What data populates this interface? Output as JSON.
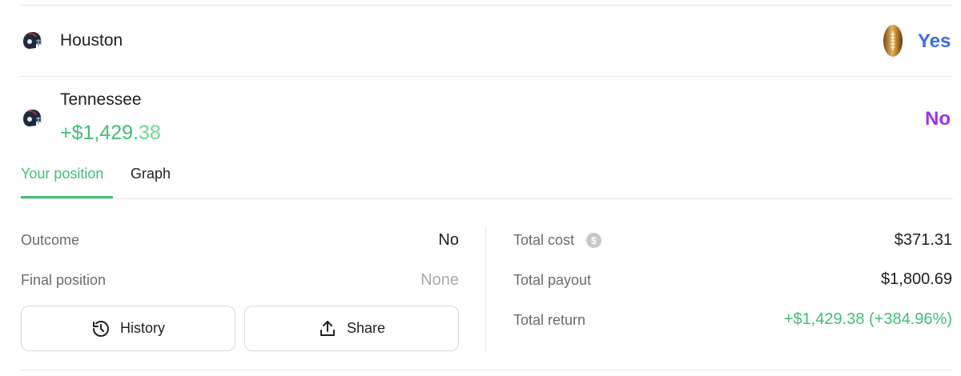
{
  "teams": [
    {
      "name": "Houston",
      "helmet_icon": "football-helmet-icon",
      "badge_icon": "gold-football-icon",
      "answer": "Yes",
      "answer_color": "#3b6cf0"
    },
    {
      "name": "Tennessee",
      "helmet_icon": "football-helmet-icon",
      "profit_dollars": "+$1,429.",
      "profit_cents": "38",
      "answer": "No",
      "answer_color": "#9b32e8"
    }
  ],
  "tabs": {
    "active": "Your position",
    "other": "Graph"
  },
  "position": {
    "outcome_label": "Outcome",
    "outcome_value": "No",
    "final_label": "Final position",
    "final_value": "None"
  },
  "buttons": {
    "history_label": "History",
    "history_icon": "history-icon",
    "share_label": "Share",
    "share_icon": "share-icon"
  },
  "totals": {
    "cost_label": "Total cost",
    "cost_icon": "dollar-coin-icon",
    "cost_value": "$371.31",
    "payout_label": "Total payout",
    "payout_value": "$1,800.69",
    "return_label": "Total return",
    "return_value": "+$1,429.38 (+384.96%)"
  },
  "colors": {
    "green": "#3fbf73",
    "blue": "#3b6cf0",
    "purple": "#9b32e8"
  }
}
